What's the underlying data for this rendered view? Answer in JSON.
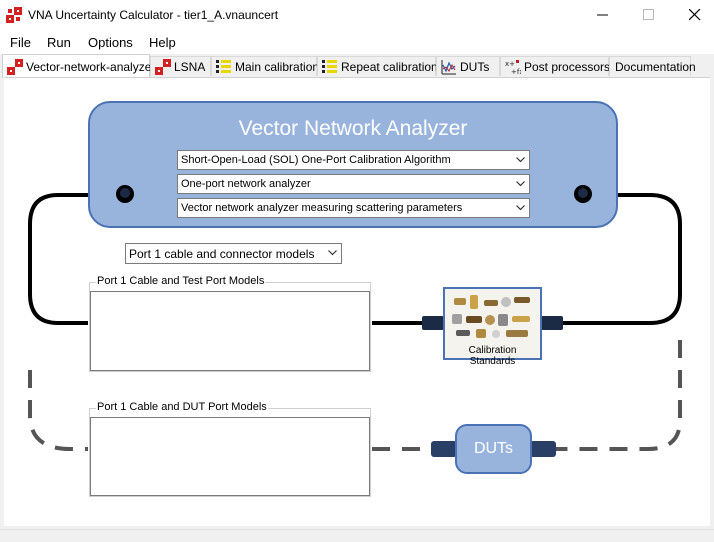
{
  "window": {
    "title": "VNA Uncertainty Calculator - tier1_A.vnauncert",
    "controls": [
      "minimize",
      "maximize",
      "close"
    ]
  },
  "menu": [
    "File",
    "Run",
    "Options",
    "Help"
  ],
  "tabs": [
    {
      "label": "Vector-network-analyzer",
      "icon": "vna-icon",
      "active": true
    },
    {
      "label": "LSNA",
      "icon": "lsna-icon",
      "active": false
    },
    {
      "label": "Main calibration",
      "icon": "calibration-icon",
      "active": false
    },
    {
      "label": "Repeat calibration",
      "icon": "calibration-icon",
      "active": false
    },
    {
      "label": "DUTs",
      "icon": "dut-chart-icon",
      "active": false
    },
    {
      "label": "Post processors",
      "icon": "post-processor-icon",
      "active": false
    },
    {
      "label": "Documentation",
      "icon": "",
      "active": false
    }
  ],
  "vna": {
    "title": "Vector Network Analyzer",
    "algorithm": "Short-Open-Load (SOL) One-Port Calibration Algorithm",
    "analyzer": "One-port network analyzer",
    "measurement": "Vector network analyzer measuring scattering parameters"
  },
  "port1_models": {
    "selected": "Port 1 cable and connector models"
  },
  "groups": {
    "test_port": "Port 1 Cable and Test Port Models",
    "dut_port": "Port 1 Cable and DUT Port Models"
  },
  "calibration_standards": {
    "label": "Calibration Standards"
  },
  "duts": {
    "label": "DUTs"
  },
  "colors": {
    "vna_fill": "#98b4dc",
    "vna_border": "#4a72b5",
    "connector": "#1b2a45",
    "cable": "#000000",
    "dashed_cable": "#555555"
  }
}
